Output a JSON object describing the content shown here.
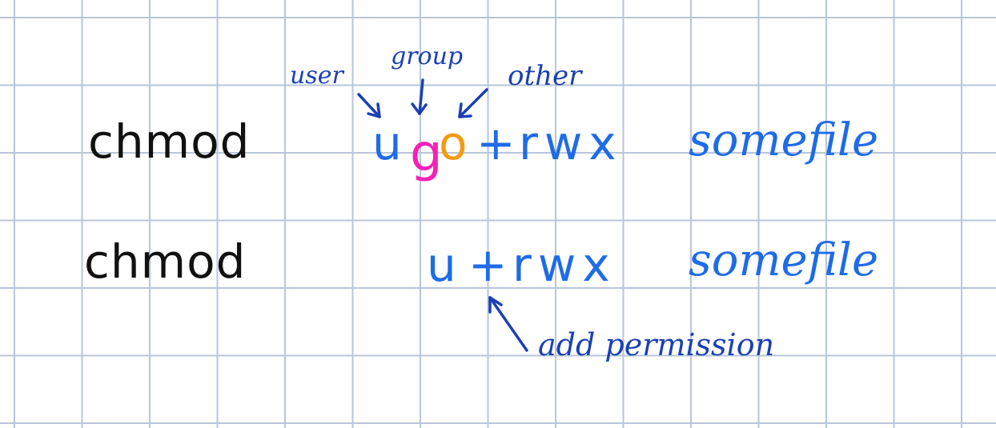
{
  "colors": {
    "ink_black": "#111111",
    "ink_blue": "#1f6be8",
    "ink_dark_blue": "#1b3fb5",
    "group_pink": "#f520b8",
    "other_orange": "#f59a12",
    "grid": "#b7c6d9"
  },
  "line1": {
    "command": "chmod",
    "user": "u",
    "group": "g",
    "other": "o",
    "operator": "+",
    "permissions": "rwx",
    "target": "somefile"
  },
  "line2": {
    "command": "chmod",
    "who": "u",
    "operator": "+",
    "permissions": "rwx",
    "target": "somefile"
  },
  "annotations": {
    "user": "user",
    "group": "group",
    "other": "other",
    "add": "add permission"
  }
}
